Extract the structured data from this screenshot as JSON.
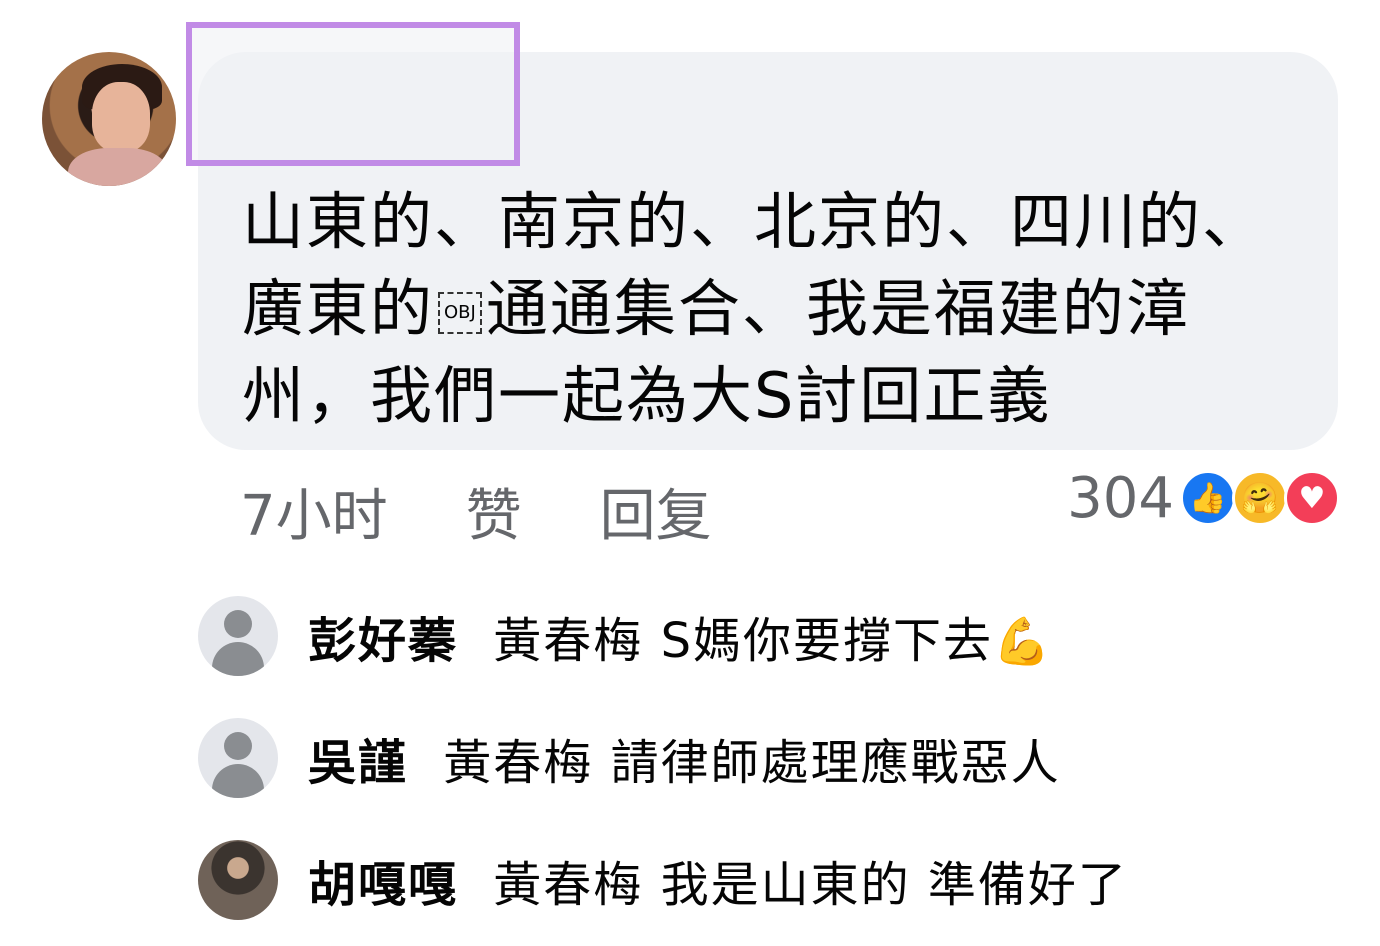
{
  "comment": {
    "text_part1": "山東的、南京的、北京的、四川的、廣東的",
    "obj_glyph": "OBJ",
    "text_part2": "通通集合、我是福建的漳州，我們一起為大S討回正義"
  },
  "actions": {
    "time": "7小时",
    "like": "赞",
    "reply": "回复"
  },
  "reactions": {
    "count": "304",
    "icons": [
      "like-icon",
      "care-icon",
      "love-icon"
    ]
  },
  "replies": [
    {
      "name": "彭好蓁",
      "mention": "黃春梅",
      "text": "S媽你要撐下去",
      "emoji": "flexed-biceps-icon",
      "avatar": "default"
    },
    {
      "name": "吳謹",
      "mention": "黃春梅",
      "text": "請律師處理應戰惡人",
      "avatar": "default"
    },
    {
      "name": "胡嘎嘎",
      "mention": "黃春梅",
      "text": "我是山東的 準備好了",
      "avatar": "photo"
    }
  ]
}
